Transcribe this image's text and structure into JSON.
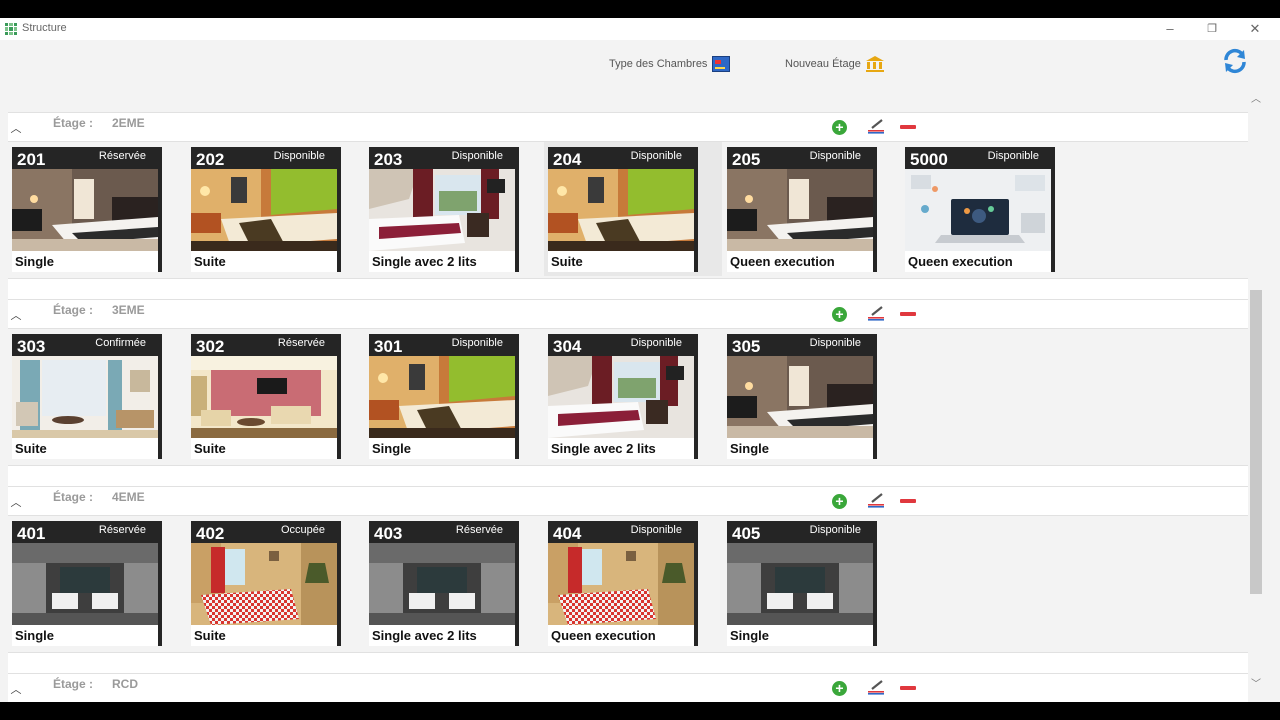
{
  "window": {
    "title": "Structure",
    "controls": {
      "minimize": "–",
      "maximize": "❐",
      "close": "✕"
    }
  },
  "toolbar": {
    "room_types_label": "Type des Chambres",
    "new_floor_label": "Nouveau Étage"
  },
  "floor_prefix": "Étage :",
  "floors": [
    {
      "name": "2EME",
      "rooms": [
        {
          "number": "201",
          "status": "Réservée",
          "type": "Single",
          "scene": "darkbed"
        },
        {
          "number": "202",
          "status": "Disponible",
          "type": "Suite",
          "scene": "warmgreen"
        },
        {
          "number": "203",
          "status": "Disponible",
          "type": "Single avec 2 lits",
          "scene": "redbeds"
        },
        {
          "number": "204",
          "status": "Disponible",
          "type": "Suite",
          "scene": "warmgreen",
          "selected": true
        },
        {
          "number": "205",
          "status": "Disponible",
          "type": "Queen execution",
          "scene": "darkbed"
        },
        {
          "number": "5000",
          "status": "Disponible",
          "type": "Queen execution",
          "scene": "laptop"
        }
      ]
    },
    {
      "name": "3EME",
      "rooms": [
        {
          "number": "303",
          "status": "Confirmée",
          "type": "Suite",
          "scene": "lounge"
        },
        {
          "number": "302",
          "status": "Réservée",
          "type": "Suite",
          "scene": "livingroom"
        },
        {
          "number": "301",
          "status": "Disponible",
          "type": "Single",
          "scene": "warmgreen"
        },
        {
          "number": "304",
          "status": "Disponible",
          "type": "Single avec 2 lits",
          "scene": "redbeds"
        },
        {
          "number": "305",
          "status": "Disponible",
          "type": "Single",
          "scene": "darkbed"
        }
      ]
    },
    {
      "name": "4EME",
      "rooms": [
        {
          "number": "401",
          "status": "Réservée",
          "type": "Single",
          "scene": "twingray"
        },
        {
          "number": "402",
          "status": "Occupée",
          "type": "Suite",
          "scene": "checker"
        },
        {
          "number": "403",
          "status": "Réservée",
          "type": "Single avec 2 lits",
          "scene": "twingray"
        },
        {
          "number": "404",
          "status": "Disponible",
          "type": "Queen execution",
          "scene": "checker"
        },
        {
          "number": "405",
          "status": "Disponible",
          "type": "Single",
          "scene": "twingray"
        }
      ]
    },
    {
      "name": "RCD",
      "rooms": []
    }
  ],
  "colors": {
    "card_header": "#252525",
    "add": "#3aa73a",
    "remove": "#e0383e",
    "floor_label": "#9a9a9a"
  }
}
